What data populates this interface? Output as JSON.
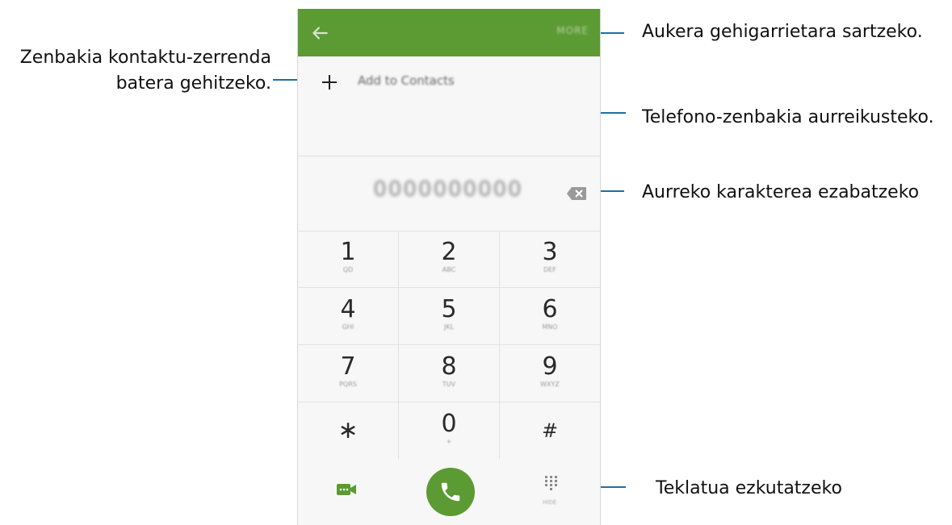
{
  "callouts": {
    "more_options": "Aukera gehigarrietara sartzeko.",
    "add_to_contacts_line1": "Zenbakia kontaktu-zerrenda",
    "add_to_contacts_line2": "batera gehitzeko.",
    "preview_number": "Telefono-zenbakia aurreikusteko.",
    "delete_char": "Aurreko karakterea ezabatzeko",
    "hide_keypad": "Teklatua ezkutatzeko"
  },
  "appbar": {
    "more_label": "MORE",
    "back_icon": "back-arrow-icon"
  },
  "add_contacts": {
    "label": "Add to Contacts",
    "icon": "plus-icon"
  },
  "dialer": {
    "number": "0000000000",
    "backspace_icon": "backspace-icon"
  },
  "keypad": {
    "keys": [
      {
        "digit": "1",
        "letters": "QD"
      },
      {
        "digit": "2",
        "letters": "ABC"
      },
      {
        "digit": "3",
        "letters": "DEF"
      },
      {
        "digit": "4",
        "letters": "GHI"
      },
      {
        "digit": "5",
        "letters": "JKL"
      },
      {
        "digit": "6",
        "letters": "MNO"
      },
      {
        "digit": "7",
        "letters": "PQRS"
      },
      {
        "digit": "8",
        "letters": "TUV"
      },
      {
        "digit": "9",
        "letters": "WXYZ"
      },
      {
        "digit": "∗",
        "letters": ""
      },
      {
        "digit": "0",
        "letters": "+"
      },
      {
        "digit": "#",
        "letters": ""
      }
    ]
  },
  "bottom": {
    "video_icon": "video-call-icon",
    "call_icon": "phone-icon",
    "keypad_icon": "keypad-toggle-icon",
    "keypad_label": "HIDE"
  },
  "colors": {
    "accent": "#5c9a33",
    "leader": "#1f6fa3"
  }
}
